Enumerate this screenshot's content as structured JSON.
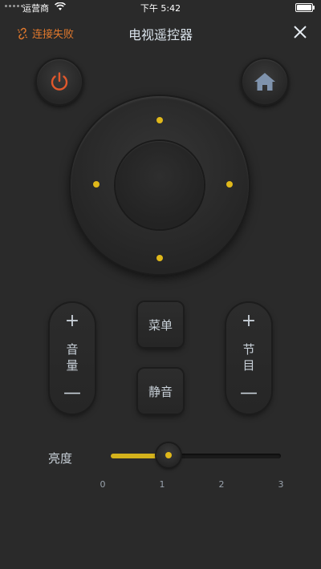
{
  "status": {
    "carrier": "运营商",
    "time": "下午 5:42"
  },
  "header": {
    "connection_status": "连接失败",
    "title": "电视遥控器"
  },
  "controls": {
    "volume_label": "音量",
    "channel_label": "节目",
    "plus": "+",
    "minus": "—",
    "menu_label": "菜单",
    "mute_label": "静音"
  },
  "brightness": {
    "label": "亮度",
    "value": 1,
    "min": 0,
    "max": 3,
    "ticks": [
      "0",
      "1",
      "2",
      "3"
    ]
  },
  "colors": {
    "accent": "#e0b81a",
    "power": "#e0582c",
    "connection_error": "#e0782c",
    "home": "#7f93ad"
  }
}
